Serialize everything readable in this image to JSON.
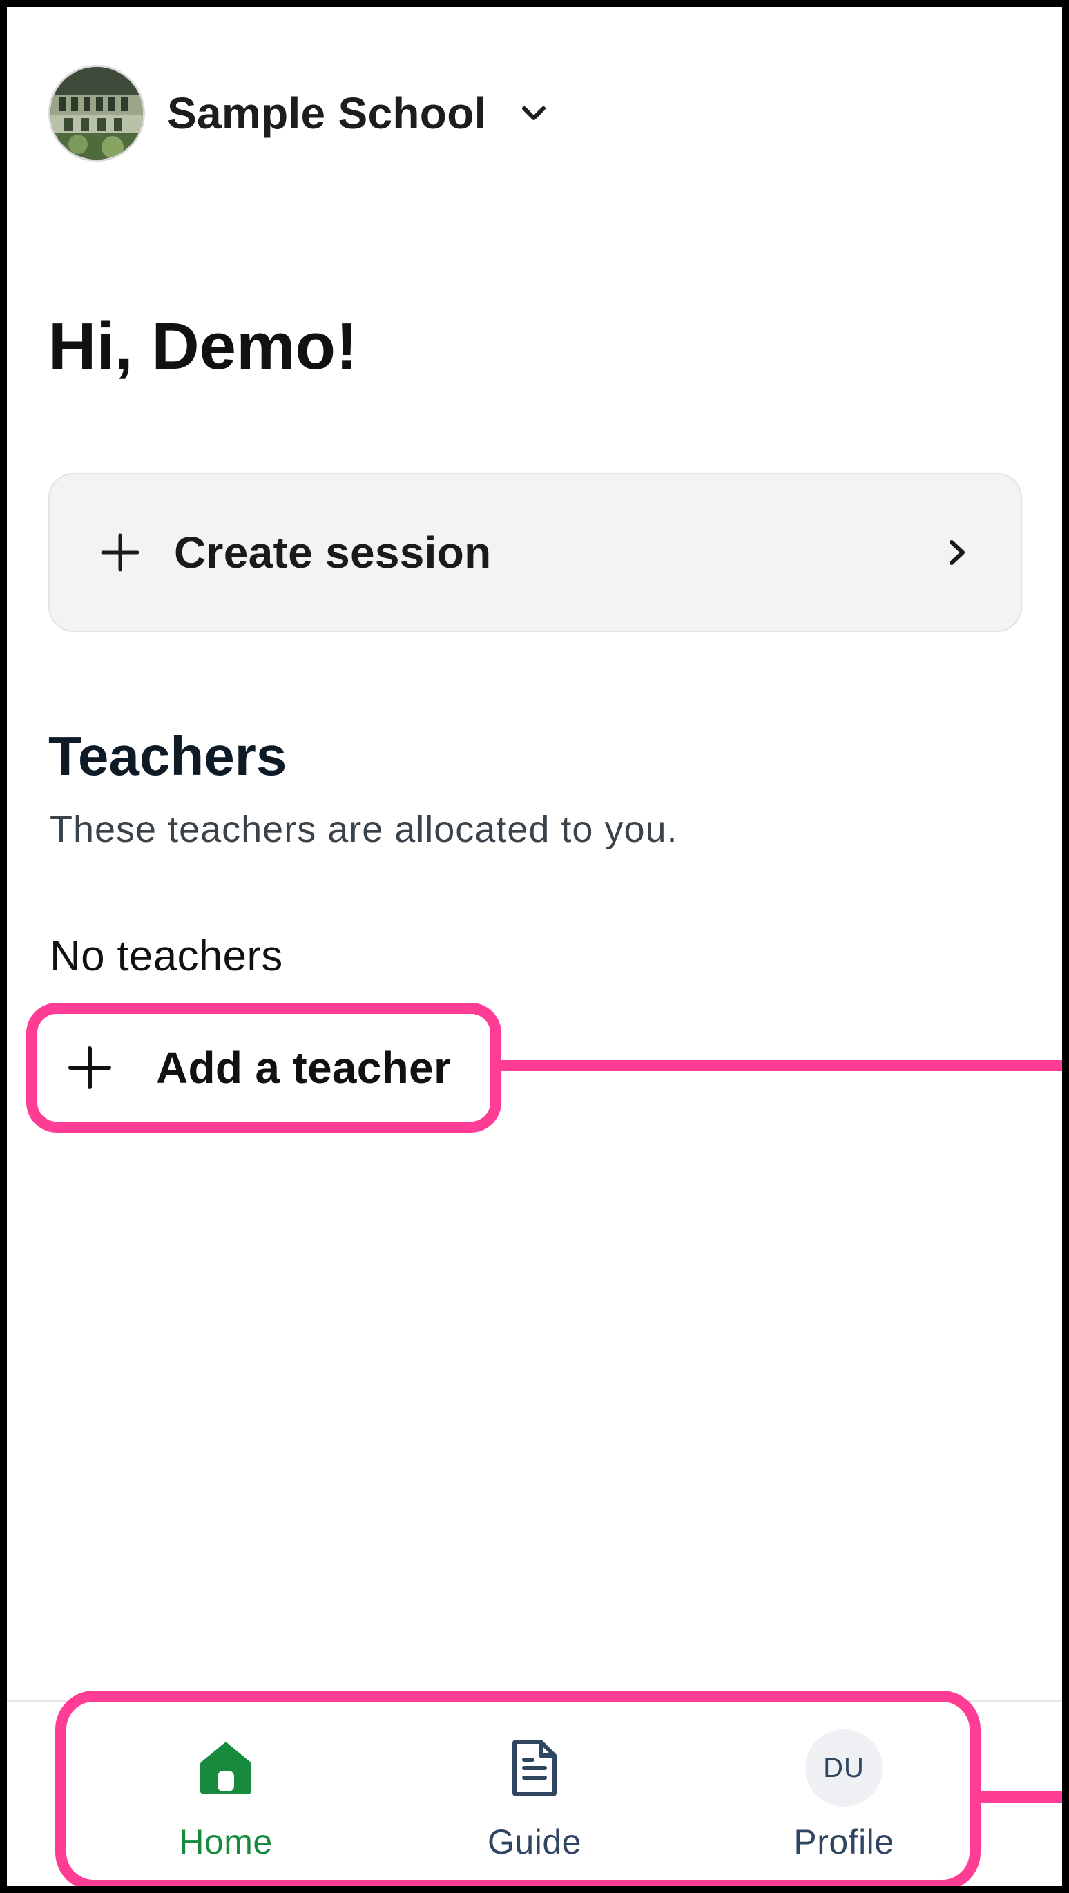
{
  "header": {
    "school_name": "Sample School",
    "avatar_icon": "school-photo-avatar",
    "dropdown_icon": "chevron-down-icon"
  },
  "greeting": "Hi, Demo!",
  "create_session": {
    "label": "Create session",
    "leading_icon": "plus-icon",
    "trailing_icon": "chevron-right-icon"
  },
  "teachers": {
    "title": "Teachers",
    "subtitle": "These teachers are allocated to you.",
    "empty_text": "No teachers",
    "add_label": "Add a teacher"
  },
  "bottom_nav": {
    "items": [
      {
        "label": "Home",
        "icon": "home-icon",
        "active": true
      },
      {
        "label": "Guide",
        "icon": "document-icon",
        "active": false
      },
      {
        "label": "Profile",
        "icon": "profile-avatar",
        "initials": "DU",
        "active": false
      }
    ]
  },
  "colors": {
    "accent_green": "#178a3e",
    "highlight_pink": "#ff3d94",
    "nav_text": "#2f4560",
    "card_bg": "#f2f3f3"
  }
}
